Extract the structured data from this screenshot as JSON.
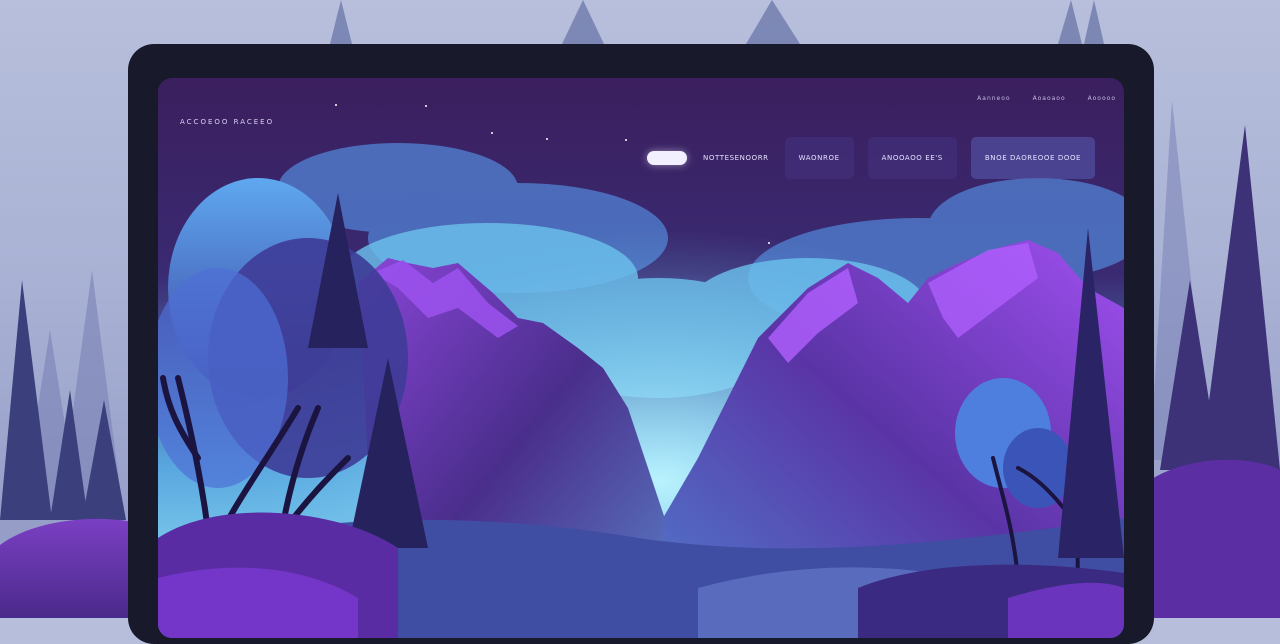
{
  "site": {
    "logo": "Accoeoo Raceeo"
  },
  "top_links": [
    "Aanneoo",
    "Aoaoaoo",
    "Aooooo"
  ],
  "nav": {
    "items": [
      "Nottesenoorr",
      "Waonroe",
      "Anooaoo Ee'S",
      "Bnoe Daoreooe Dooe"
    ]
  },
  "colors": {
    "sky_top": "#3a1f5c",
    "sky_glow": "#7fd6f0",
    "mountain": "#6a36b8",
    "frame": "#181a2b",
    "accent": "#a24dff"
  },
  "icons": [
    "star-icon"
  ]
}
